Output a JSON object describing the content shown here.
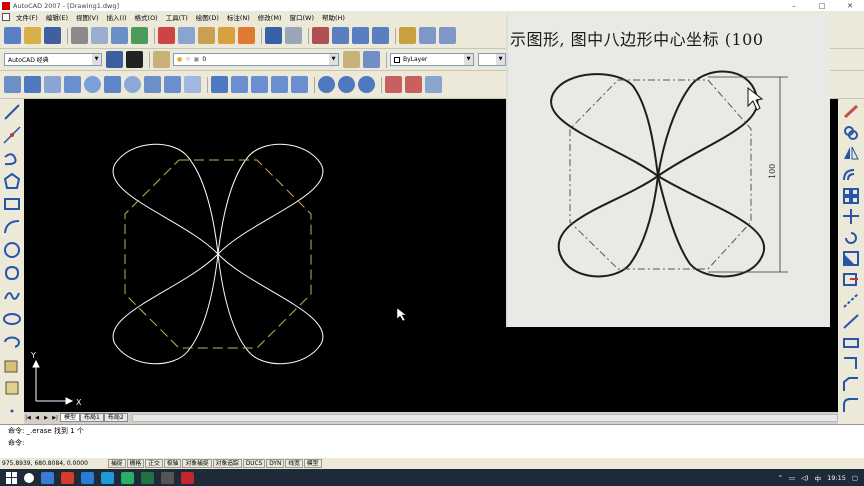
{
  "window": {
    "title": "AutoCAD 2007 - [Drawing1.dwg]",
    "controls": [
      "–",
      "□",
      "✕"
    ]
  },
  "menu": [
    "文件(F)",
    "编辑(E)",
    "视图(V)",
    "插入(I)",
    "格式(O)",
    "工具(T)",
    "绘图(D)",
    "标注(N)",
    "修改(M)",
    "窗口(W)",
    "帮助(H)"
  ],
  "toolbar": {
    "workspace": "AutoCAD 经典",
    "layer": "0",
    "color": "ByLayer"
  },
  "tabs": {
    "model": "模型",
    "layout1": "布局1",
    "layout2": "布局2"
  },
  "ucs": {
    "x": "X",
    "y": "Y"
  },
  "command": {
    "line1": "命令: _.erase 找到 1 个",
    "line2": "命令:"
  },
  "status": {
    "coords": "975.8939, 680.8084, 0.0000",
    "buttons": [
      "捕捉",
      "栅格",
      "正交",
      "极轴",
      "对象捕捉",
      "对象追踪",
      "DUCS",
      "DYN",
      "线宽",
      "模型"
    ]
  },
  "taskbar": {
    "time": "19:15",
    "ime": "中"
  },
  "photo": {
    "caption": "示图形, 图中八边形中心坐标 (100",
    "dimension": "100"
  },
  "colors": {
    "canvas": "#000000",
    "curve": "#ffffff",
    "octagon": "#c8b050",
    "taskbar": "#1f2a38"
  }
}
